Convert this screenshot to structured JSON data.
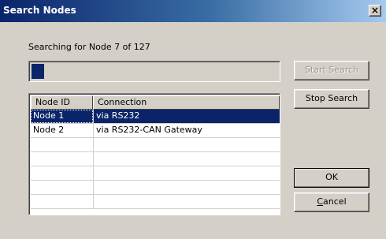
{
  "window": {
    "title": "Search Nodes",
    "close_glyph": "×"
  },
  "status_text": "Searching for Node 7 of 127",
  "progress": {
    "fraction": 0.05
  },
  "buttons": {
    "start_search": "Start Search",
    "stop_search": "Stop Search",
    "ok": "OK",
    "cancel_first": "C",
    "cancel_rest": "ancel"
  },
  "table": {
    "columns": [
      "Node ID",
      "Connection"
    ],
    "rows": [
      {
        "node_id": "Node 1",
        "connection": "via RS232",
        "selected": true
      },
      {
        "node_id": "Node 2",
        "connection": "via RS232-CAN Gateway",
        "selected": false
      }
    ]
  },
  "colors": {
    "title_start": "#0a246a",
    "title_end": "#a6caf0",
    "selection": "#0a246a",
    "face": "#d4d0c8"
  }
}
